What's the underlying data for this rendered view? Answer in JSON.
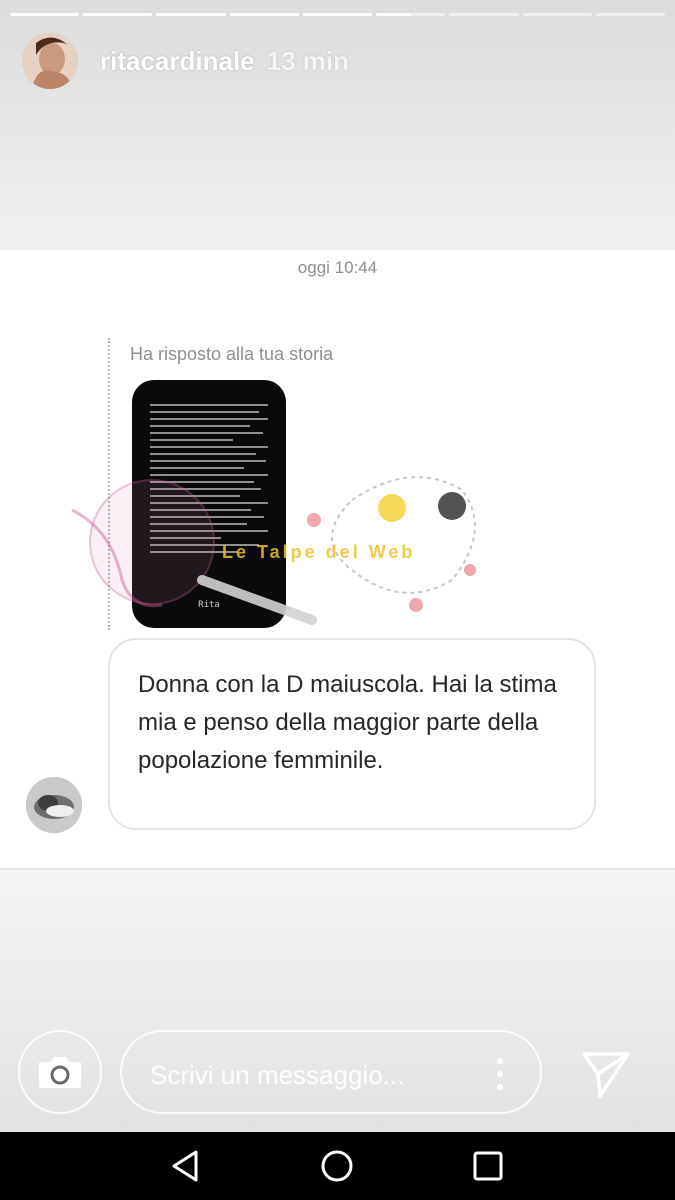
{
  "story": {
    "progress": [
      1,
      1,
      1,
      1,
      1,
      0.5,
      0,
      0,
      0
    ]
  },
  "header": {
    "username": "ritacardinale",
    "time": "13 min"
  },
  "conversation": {
    "timestamp": "oggi 10:44",
    "reply_label": "Ha risposto alla tua storia",
    "story_signature": "Rita",
    "message": "Donna con la D maiuscola. Hai la stima mia e penso della maggior parte della popolazione femminile.",
    "watermark_text": "Le Talpe del Web"
  },
  "composer": {
    "placeholder": "Scrivi un messaggio..."
  },
  "icons": {
    "camera": "camera-icon",
    "more": "more-vertical-icon",
    "send": "send-icon",
    "back": "nav-back-icon",
    "home": "nav-home-icon",
    "recents": "nav-recents-icon"
  },
  "colors": {
    "bubble_border": "#e3e3e3",
    "text": "#262626",
    "muted": "#8e8e8e",
    "navbar": "#000000"
  }
}
